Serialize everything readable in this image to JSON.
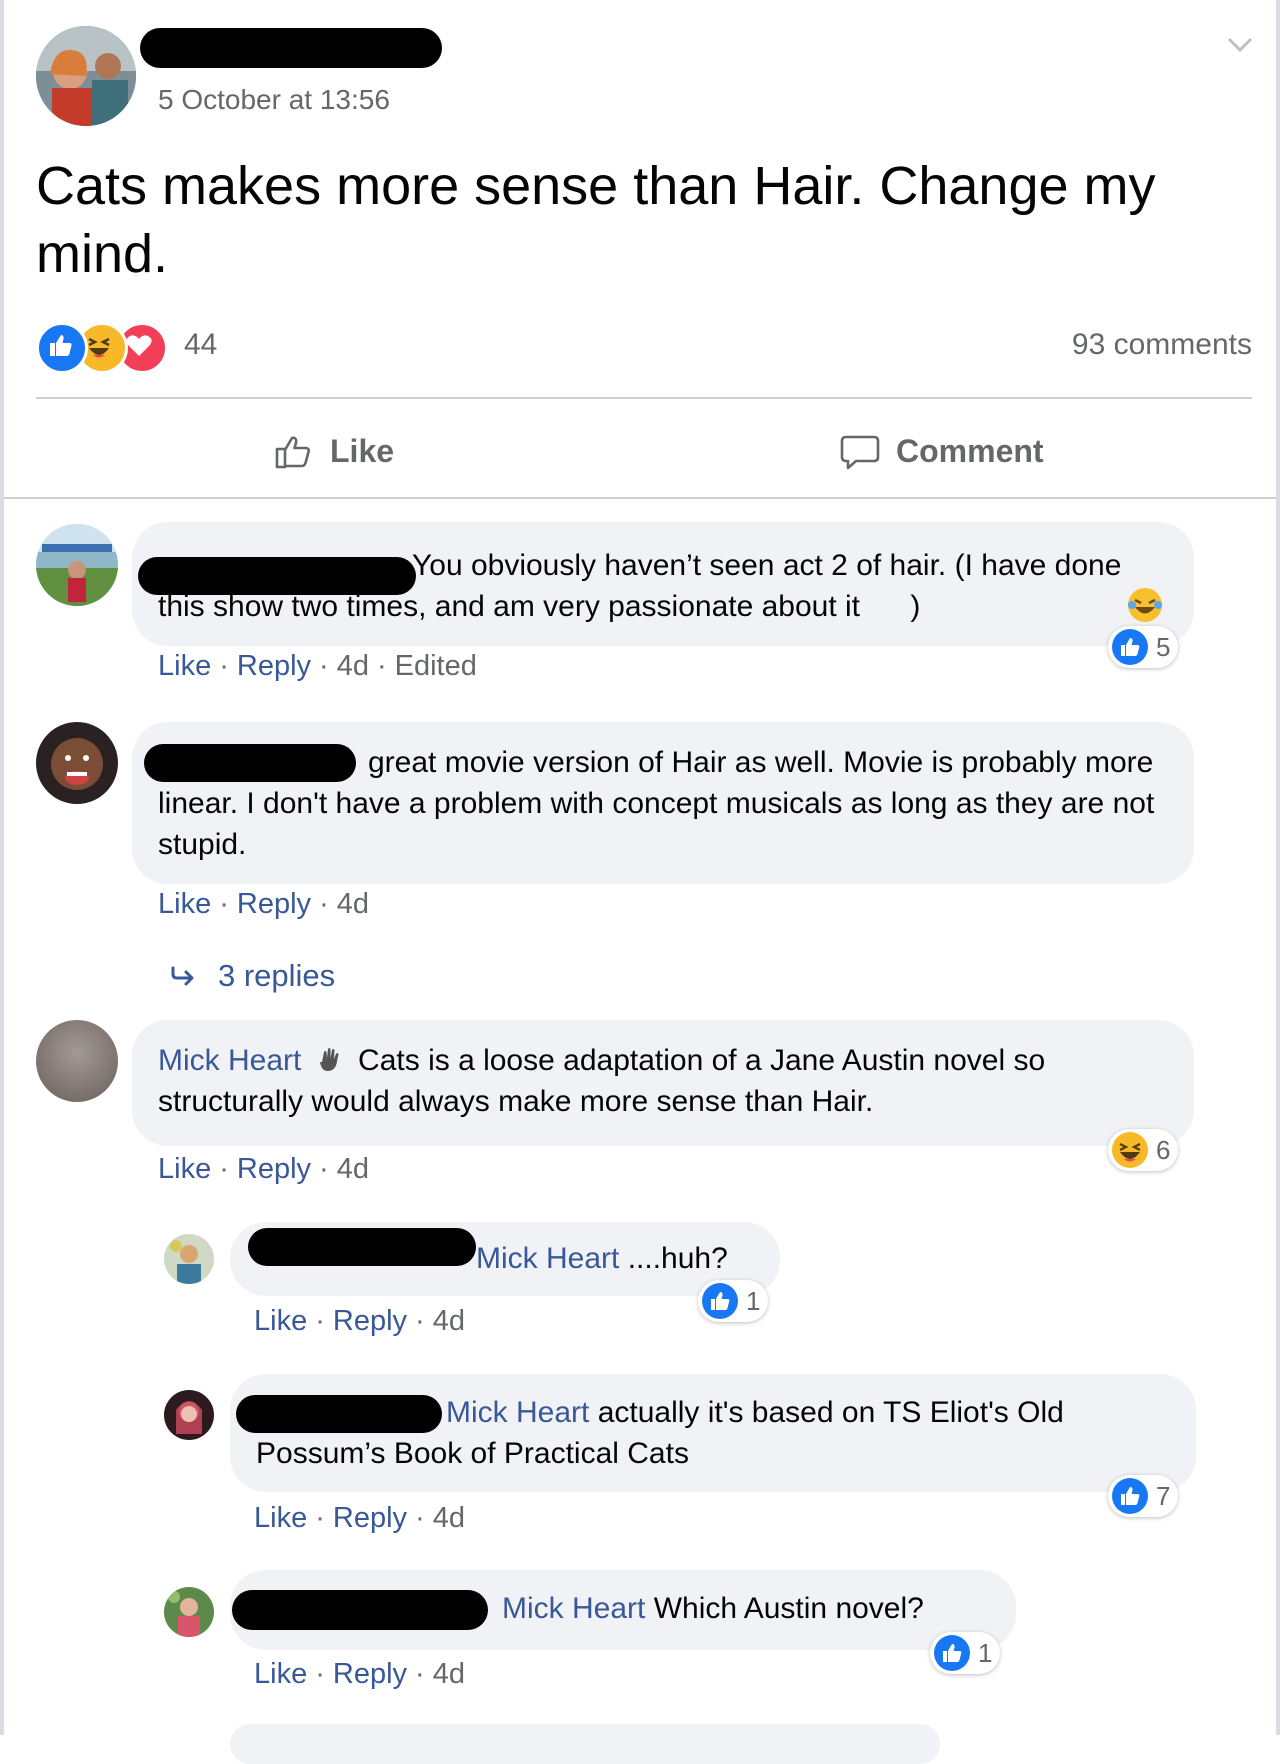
{
  "post": {
    "date": "5 October at 13:56",
    "text": "Cats makes more sense than Hair. Change my mind.",
    "reaction_count": "44",
    "comments_count": "93 comments",
    "reactions": [
      "like",
      "haha",
      "love"
    ]
  },
  "actions": {
    "like": "Like",
    "comment": "Comment"
  },
  "comments": [
    {
      "text": "You obviously haven’t seen act 2 of hair. (I have done this show two times, and am very passionate about it",
      "text_end": ")",
      "meta": {
        "like": "Like",
        "reply": "Reply",
        "time": "4d",
        "edited": "Edited"
      },
      "reaction": {
        "type": "like",
        "count": "5"
      }
    },
    {
      "text": "great movie version of Hair as well. Movie is probably more linear. I don't have a problem with concept musicals as long as they are not stupid.",
      "meta": {
        "like": "Like",
        "reply": "Reply",
        "time": "4d"
      },
      "replies": "3 replies"
    },
    {
      "author": "Mick Heart",
      "text": "Cats is a loose adaptation of a Jane Austin novel so structurally would always make more sense than Hair.",
      "meta": {
        "like": "Like",
        "reply": "Reply",
        "time": "4d"
      },
      "reaction": {
        "type": "haha",
        "count": "6"
      }
    }
  ],
  "replies": [
    {
      "mention": "Mick Heart",
      "text": " ....huh?",
      "meta": {
        "like": "Like",
        "reply": "Reply",
        "time": "4d"
      },
      "reaction": {
        "type": "like",
        "count": "1"
      }
    },
    {
      "mention": "Mick Heart",
      "text": " actually it's based on TS Eliot's Old Possum’s Book of Practical Cats",
      "meta": {
        "like": "Like",
        "reply": "Reply",
        "time": "4d"
      },
      "reaction": {
        "type": "like",
        "count": "7"
      }
    },
    {
      "mention": "Mick Heart",
      "text": " Which Austin novel?",
      "meta": {
        "like": "Like",
        "reply": "Reply",
        "time": "4d"
      },
      "reaction": {
        "type": "like",
        "count": "1"
      }
    }
  ],
  "colors": {
    "link": "#385898",
    "meta": "#65676b",
    "like_blue": "#1877f2",
    "haha_yellow": "#f7b928",
    "love_red": "#f33e58",
    "bubble": "#f0f2f5"
  }
}
